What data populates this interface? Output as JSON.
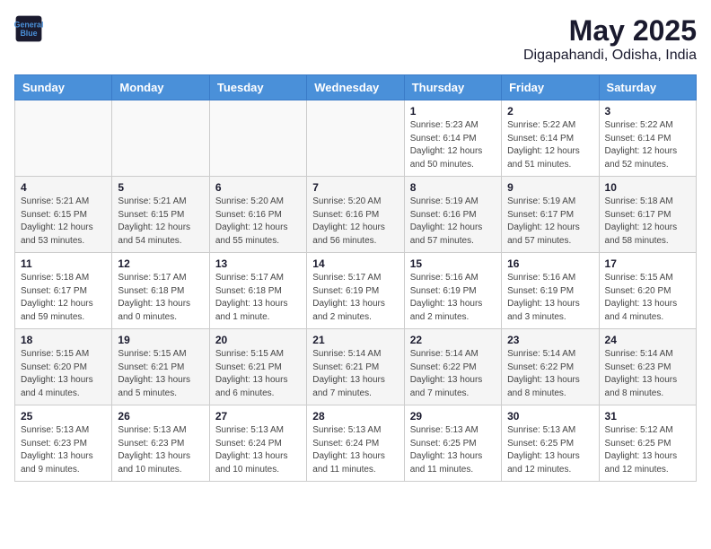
{
  "logo": {
    "line1": "General",
    "line2": "Blue"
  },
  "title": "May 2025",
  "subtitle": "Digapahandi, Odisha, India",
  "weekdays": [
    "Sunday",
    "Monday",
    "Tuesday",
    "Wednesday",
    "Thursday",
    "Friday",
    "Saturday"
  ],
  "weeks": [
    [
      {
        "day": "",
        "info": ""
      },
      {
        "day": "",
        "info": ""
      },
      {
        "day": "",
        "info": ""
      },
      {
        "day": "",
        "info": ""
      },
      {
        "day": "1",
        "info": "Sunrise: 5:23 AM\nSunset: 6:14 PM\nDaylight: 12 hours\nand 50 minutes."
      },
      {
        "day": "2",
        "info": "Sunrise: 5:22 AM\nSunset: 6:14 PM\nDaylight: 12 hours\nand 51 minutes."
      },
      {
        "day": "3",
        "info": "Sunrise: 5:22 AM\nSunset: 6:14 PM\nDaylight: 12 hours\nand 52 minutes."
      }
    ],
    [
      {
        "day": "4",
        "info": "Sunrise: 5:21 AM\nSunset: 6:15 PM\nDaylight: 12 hours\nand 53 minutes."
      },
      {
        "day": "5",
        "info": "Sunrise: 5:21 AM\nSunset: 6:15 PM\nDaylight: 12 hours\nand 54 minutes."
      },
      {
        "day": "6",
        "info": "Sunrise: 5:20 AM\nSunset: 6:16 PM\nDaylight: 12 hours\nand 55 minutes."
      },
      {
        "day": "7",
        "info": "Sunrise: 5:20 AM\nSunset: 6:16 PM\nDaylight: 12 hours\nand 56 minutes."
      },
      {
        "day": "8",
        "info": "Sunrise: 5:19 AM\nSunset: 6:16 PM\nDaylight: 12 hours\nand 57 minutes."
      },
      {
        "day": "9",
        "info": "Sunrise: 5:19 AM\nSunset: 6:17 PM\nDaylight: 12 hours\nand 57 minutes."
      },
      {
        "day": "10",
        "info": "Sunrise: 5:18 AM\nSunset: 6:17 PM\nDaylight: 12 hours\nand 58 minutes."
      }
    ],
    [
      {
        "day": "11",
        "info": "Sunrise: 5:18 AM\nSunset: 6:17 PM\nDaylight: 12 hours\nand 59 minutes."
      },
      {
        "day": "12",
        "info": "Sunrise: 5:17 AM\nSunset: 6:18 PM\nDaylight: 13 hours\nand 0 minutes."
      },
      {
        "day": "13",
        "info": "Sunrise: 5:17 AM\nSunset: 6:18 PM\nDaylight: 13 hours\nand 1 minute."
      },
      {
        "day": "14",
        "info": "Sunrise: 5:17 AM\nSunset: 6:19 PM\nDaylight: 13 hours\nand 2 minutes."
      },
      {
        "day": "15",
        "info": "Sunrise: 5:16 AM\nSunset: 6:19 PM\nDaylight: 13 hours\nand 2 minutes."
      },
      {
        "day": "16",
        "info": "Sunrise: 5:16 AM\nSunset: 6:19 PM\nDaylight: 13 hours\nand 3 minutes."
      },
      {
        "day": "17",
        "info": "Sunrise: 5:15 AM\nSunset: 6:20 PM\nDaylight: 13 hours\nand 4 minutes."
      }
    ],
    [
      {
        "day": "18",
        "info": "Sunrise: 5:15 AM\nSunset: 6:20 PM\nDaylight: 13 hours\nand 4 minutes."
      },
      {
        "day": "19",
        "info": "Sunrise: 5:15 AM\nSunset: 6:21 PM\nDaylight: 13 hours\nand 5 minutes."
      },
      {
        "day": "20",
        "info": "Sunrise: 5:15 AM\nSunset: 6:21 PM\nDaylight: 13 hours\nand 6 minutes."
      },
      {
        "day": "21",
        "info": "Sunrise: 5:14 AM\nSunset: 6:21 PM\nDaylight: 13 hours\nand 7 minutes."
      },
      {
        "day": "22",
        "info": "Sunrise: 5:14 AM\nSunset: 6:22 PM\nDaylight: 13 hours\nand 7 minutes."
      },
      {
        "day": "23",
        "info": "Sunrise: 5:14 AM\nSunset: 6:22 PM\nDaylight: 13 hours\nand 8 minutes."
      },
      {
        "day": "24",
        "info": "Sunrise: 5:14 AM\nSunset: 6:23 PM\nDaylight: 13 hours\nand 8 minutes."
      }
    ],
    [
      {
        "day": "25",
        "info": "Sunrise: 5:13 AM\nSunset: 6:23 PM\nDaylight: 13 hours\nand 9 minutes."
      },
      {
        "day": "26",
        "info": "Sunrise: 5:13 AM\nSunset: 6:23 PM\nDaylight: 13 hours\nand 10 minutes."
      },
      {
        "day": "27",
        "info": "Sunrise: 5:13 AM\nSunset: 6:24 PM\nDaylight: 13 hours\nand 10 minutes."
      },
      {
        "day": "28",
        "info": "Sunrise: 5:13 AM\nSunset: 6:24 PM\nDaylight: 13 hours\nand 11 minutes."
      },
      {
        "day": "29",
        "info": "Sunrise: 5:13 AM\nSunset: 6:25 PM\nDaylight: 13 hours\nand 11 minutes."
      },
      {
        "day": "30",
        "info": "Sunrise: 5:13 AM\nSunset: 6:25 PM\nDaylight: 13 hours\nand 12 minutes."
      },
      {
        "day": "31",
        "info": "Sunrise: 5:12 AM\nSunset: 6:25 PM\nDaylight: 13 hours\nand 12 minutes."
      }
    ]
  ]
}
